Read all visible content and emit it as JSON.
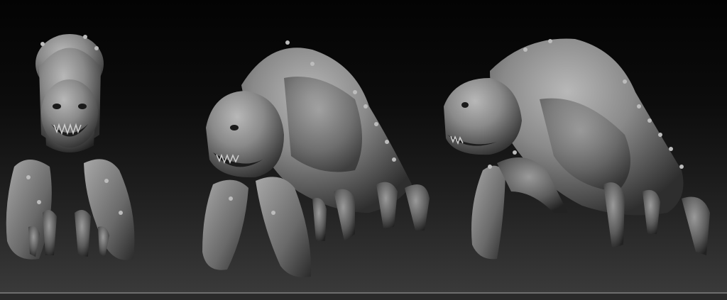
{
  "scene": {
    "background_top": "#030303",
    "background_bottom": "#3a3a3a",
    "material_color": "#8a8a8a",
    "views": [
      {
        "name": "front-view",
        "subject": "creature-sculpt"
      },
      {
        "name": "three-quarter-view",
        "subject": "creature-sculpt"
      },
      {
        "name": "side-view",
        "subject": "creature-sculpt"
      }
    ]
  }
}
